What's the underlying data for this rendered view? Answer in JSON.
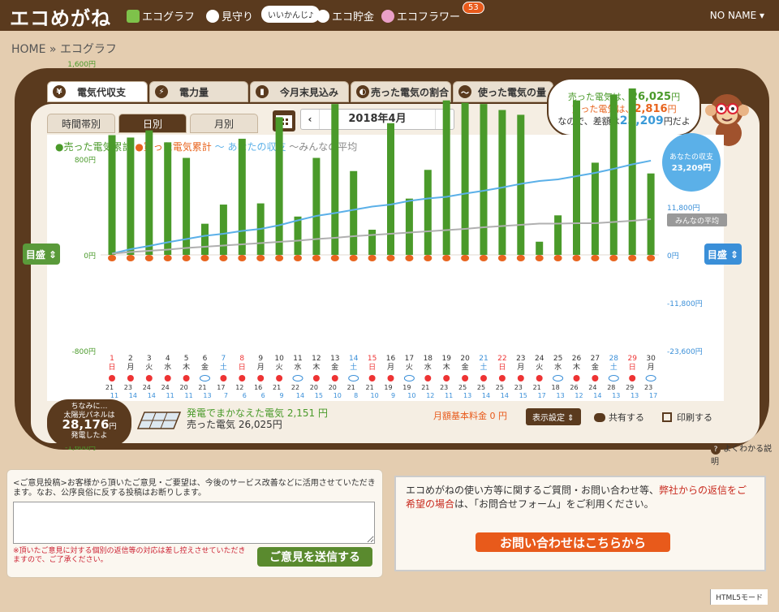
{
  "app": {
    "logo": "エコめがね",
    "user": "NO NAME ▾"
  },
  "nav": [
    {
      "label": "エコグラフ",
      "color": "#7ec24a"
    },
    {
      "label": "見守り",
      "color": "#ffffff"
    },
    {
      "label": "エコ貯金",
      "color": "#ffffff"
    },
    {
      "label": "エコフラワー",
      "color": "#e9a0c8"
    }
  ],
  "nav_bubble": "いいかんじ♪",
  "nav_badge": "53",
  "breadcrumb": "HOME » エコグラフ",
  "tabs": [
    "電気代収支",
    "電力量",
    "今月末見込み",
    "売った電気の割合",
    "使った電気の量"
  ],
  "tab_icons": [
    "¥",
    "⚡",
    "▮",
    "◐",
    "〜"
  ],
  "subtabs": [
    "時間帯別",
    "日別",
    "月別"
  ],
  "month": "2018年4月",
  "callout": {
    "l1a": "売った電気は、",
    "l1b": "26,025",
    "l1c": "円",
    "l2a": "買った電気は、",
    "l2b": "2,816",
    "l2c": "円",
    "l3a": "なので、差額は",
    "l3b": "23,209",
    "l3c": "円だよ"
  },
  "legend": {
    "sold": "●売った電気累計",
    "bought": "●買った電気累計",
    "yours": "〜 あなたの収支",
    "avg": "〜みんなの平均"
  },
  "scale_button": "目盛 ⇕",
  "info": {
    "l1": "ちなみに…",
    "l2": "太陽光パネルは",
    "big": "28,176",
    "unit": "円",
    "l3": "発電したよ"
  },
  "gen": {
    "l1": "発電でまかなえた電気 2,151 円",
    "l2": "売った電気 26,025円"
  },
  "base_fee": "月額基本料金 0 円",
  "display_btn": "表示設定 ⇕",
  "share": "共有する",
  "print": "印刷する",
  "help": "よくわかる説明",
  "feedback": {
    "text": "<ご意見投稿>お客様から頂いたご意見・ご要望は、今後のサービス改善などに活用させていただきます。なお、公序良俗に反する投稿はお断りします。",
    "note": "※頂いたご意見に対する個別の返信等の対応は差し控えさせていただきますので、ご了承ください。",
    "send": "ご意見を送信する"
  },
  "contact": {
    "t1": "エコめがねの使い方等に関するご質問・お問い合わせ等、",
    "t2": "弊社からの返信をご希望の場合",
    "t3": "は、「お問合せフォーム」をご利用ください。",
    "btn": "お問い合わせはこちらから"
  },
  "footer": "HTML5モード",
  "chart_data": {
    "type": "bar",
    "categories": [
      "1",
      "2",
      "3",
      "4",
      "5",
      "6",
      "7",
      "8",
      "9",
      "10",
      "11",
      "12",
      "13",
      "14",
      "15",
      "16",
      "17",
      "18",
      "19",
      "20",
      "21",
      "22",
      "23",
      "24",
      "25",
      "26",
      "27",
      "28",
      "29",
      "30"
    ],
    "weekdays": [
      "日",
      "月",
      "火",
      "水",
      "木",
      "金",
      "土",
      "日",
      "月",
      "火",
      "水",
      "木",
      "金",
      "土",
      "日",
      "月",
      "火",
      "水",
      "木",
      "金",
      "土",
      "日",
      "月",
      "火",
      "水",
      "木",
      "金",
      "土",
      "日",
      "月"
    ],
    "weekday_colors": {
      "sat": "#3a8fd8",
      "sun": "#e33",
      "weekday": "#333"
    },
    "high_temps": [
      "21",
      "23",
      "24",
      "24",
      "20",
      "21",
      "17",
      "12",
      "16",
      "21",
      "22",
      "20",
      "20",
      "21",
      "21",
      "19",
      "19",
      "21",
      "23",
      "25",
      "25",
      "25",
      "23",
      "21",
      "18",
      "26",
      "24",
      "28",
      "29",
      "23"
    ],
    "low_temps": [
      "11",
      "14",
      "14",
      "11",
      "11",
      "13",
      "7",
      "6",
      "6",
      "9",
      "14",
      "15",
      "10",
      "8",
      "10",
      "9",
      "10",
      "12",
      "11",
      "13",
      "14",
      "14",
      "15",
      "17",
      "13",
      "12",
      "14",
      "13",
      "13",
      "17"
    ],
    "weather": [
      "sun",
      "sun",
      "sun",
      "sun",
      "sun",
      "cloud",
      "sun",
      "sun",
      "sun",
      "sun",
      "cloud",
      "sun",
      "sun",
      "cloud",
      "sun",
      "sun",
      "cloud",
      "sun",
      "sun",
      "sun",
      "sun",
      "sun",
      "sun",
      "sun",
      "cloud",
      "sun",
      "sun",
      "cloud",
      "sun",
      "cloud"
    ],
    "series": [
      {
        "name": "売った電気累計",
        "color": "#4a9a2a",
        "values": [
          1000,
          980,
          1040,
          940,
          810,
          260,
          420,
          970,
          430,
          1150,
          320,
          810,
          1260,
          700,
          210,
          1100,
          470,
          710,
          1290,
          1270,
          1260,
          1210,
          1170,
          110,
          330,
          1290,
          770,
          1340,
          1390,
          680
        ]
      },
      {
        "name": "買った電気累計",
        "color": "#e8641e",
        "values": [
          -70,
          -80,
          -70,
          -70,
          -80,
          -80,
          -90,
          -80,
          -80,
          -70,
          -70,
          -80,
          -70,
          -80,
          -80,
          -70,
          -80,
          -80,
          -70,
          -80,
          -70,
          -70,
          -80,
          -70,
          -80,
          -70,
          -70,
          -80,
          -70,
          -80
        ]
      },
      {
        "name": "あなたの収支",
        "color": "#5bb0e8",
        "values": [
          300,
          1400,
          2200,
          3100,
          3900,
          4700,
          5200,
          5900,
          6400,
          7300,
          8500,
          9600,
          10300,
          11100,
          11900,
          12400,
          13300,
          13900,
          14300,
          15100,
          15800,
          16600,
          17500,
          18200,
          18600,
          19400,
          20200,
          21200,
          22300,
          23209
        ]
      },
      {
        "name": "みんなの平均",
        "color": "#b0b0b0",
        "values": [
          300,
          700,
          1000,
          1300,
          1700,
          2000,
          2300,
          2600,
          2900,
          3200,
          3500,
          3900,
          4200,
          4600,
          4900,
          5200,
          5500,
          5800,
          6100,
          6400,
          6800,
          7100,
          7400,
          7700,
          7700,
          7800,
          7800,
          8100,
          8400,
          8800
        ]
      }
    ],
    "ylim_left": [
      -1600,
      1600
    ],
    "yticks_left": [
      "1,600円",
      "800円",
      "0円",
      "-800円",
      "-1,600円"
    ],
    "ylim_right": [
      -23600,
      23600
    ],
    "yticks_right": [
      "11,800円",
      "0円",
      "-11,800円",
      "-23,600円"
    ],
    "annot_yours": {
      "l1": "あなたの収支",
      "l2": "23,209円"
    },
    "annot_avg": "みんなの平均",
    "grid": false
  }
}
